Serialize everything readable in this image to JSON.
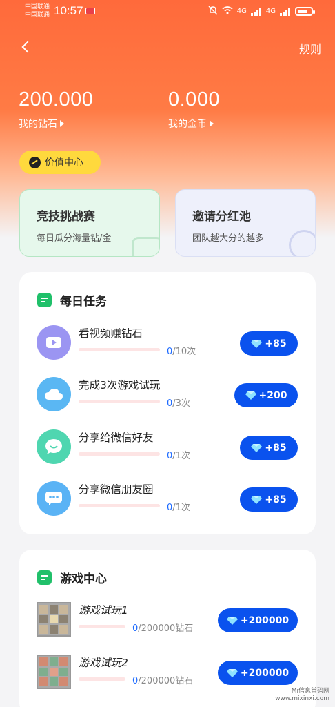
{
  "status": {
    "carrier1": "中国联通",
    "carrier2": "中国联通",
    "time": "10:57",
    "net1": "4G",
    "net2": "4G"
  },
  "header": {
    "rules": "规则"
  },
  "balances": {
    "diamonds_value": "200.000",
    "diamonds_label": "我的钻石",
    "coins_value": "0.000",
    "coins_label": "我的金币"
  },
  "value_center": "价值中心",
  "promos": [
    {
      "title": "竞技挑战赛",
      "subtitle": "每日瓜分海量钻/金"
    },
    {
      "title": "邀请分红池",
      "subtitle": "团队越大分的越多"
    }
  ],
  "daily_tasks": {
    "title": "每日任务",
    "items": [
      {
        "name": "看视频赚钻石",
        "current": "0",
        "total": "/10次",
        "reward": "+85",
        "progress": 0,
        "icon": "video-icon"
      },
      {
        "name": "完成3次游戏试玩",
        "current": "0",
        "total": "/3次",
        "reward": "+200",
        "progress": 0,
        "icon": "cloud-icon"
      },
      {
        "name": "分享给微信好友",
        "current": "0",
        "total": "/1次",
        "reward": "+85",
        "progress": 0,
        "icon": "chat-bubble-icon"
      },
      {
        "name": "分享微信朋友圈",
        "current": "0",
        "total": "/1次",
        "reward": "+85",
        "progress": 0,
        "icon": "message-dots-icon"
      }
    ]
  },
  "game_center": {
    "title": "游戏中心",
    "items": [
      {
        "name": "游戏试玩1",
        "current": "0",
        "total": "/200000钻石",
        "reward": "+200000",
        "progress": 0
      },
      {
        "name": "游戏试玩2",
        "current": "0",
        "total": "/200000钻石",
        "reward": "+200000",
        "progress": 0
      }
    ]
  },
  "watermark": {
    "line1": "Mi信息首码网",
    "line2": "www.mixinxi.com"
  },
  "colors": {
    "header_orange": "#ff6a3b",
    "reward_blue": "#0a52ee",
    "accent_green": "#20c06a",
    "badge_yellow": "#ffd93d"
  }
}
